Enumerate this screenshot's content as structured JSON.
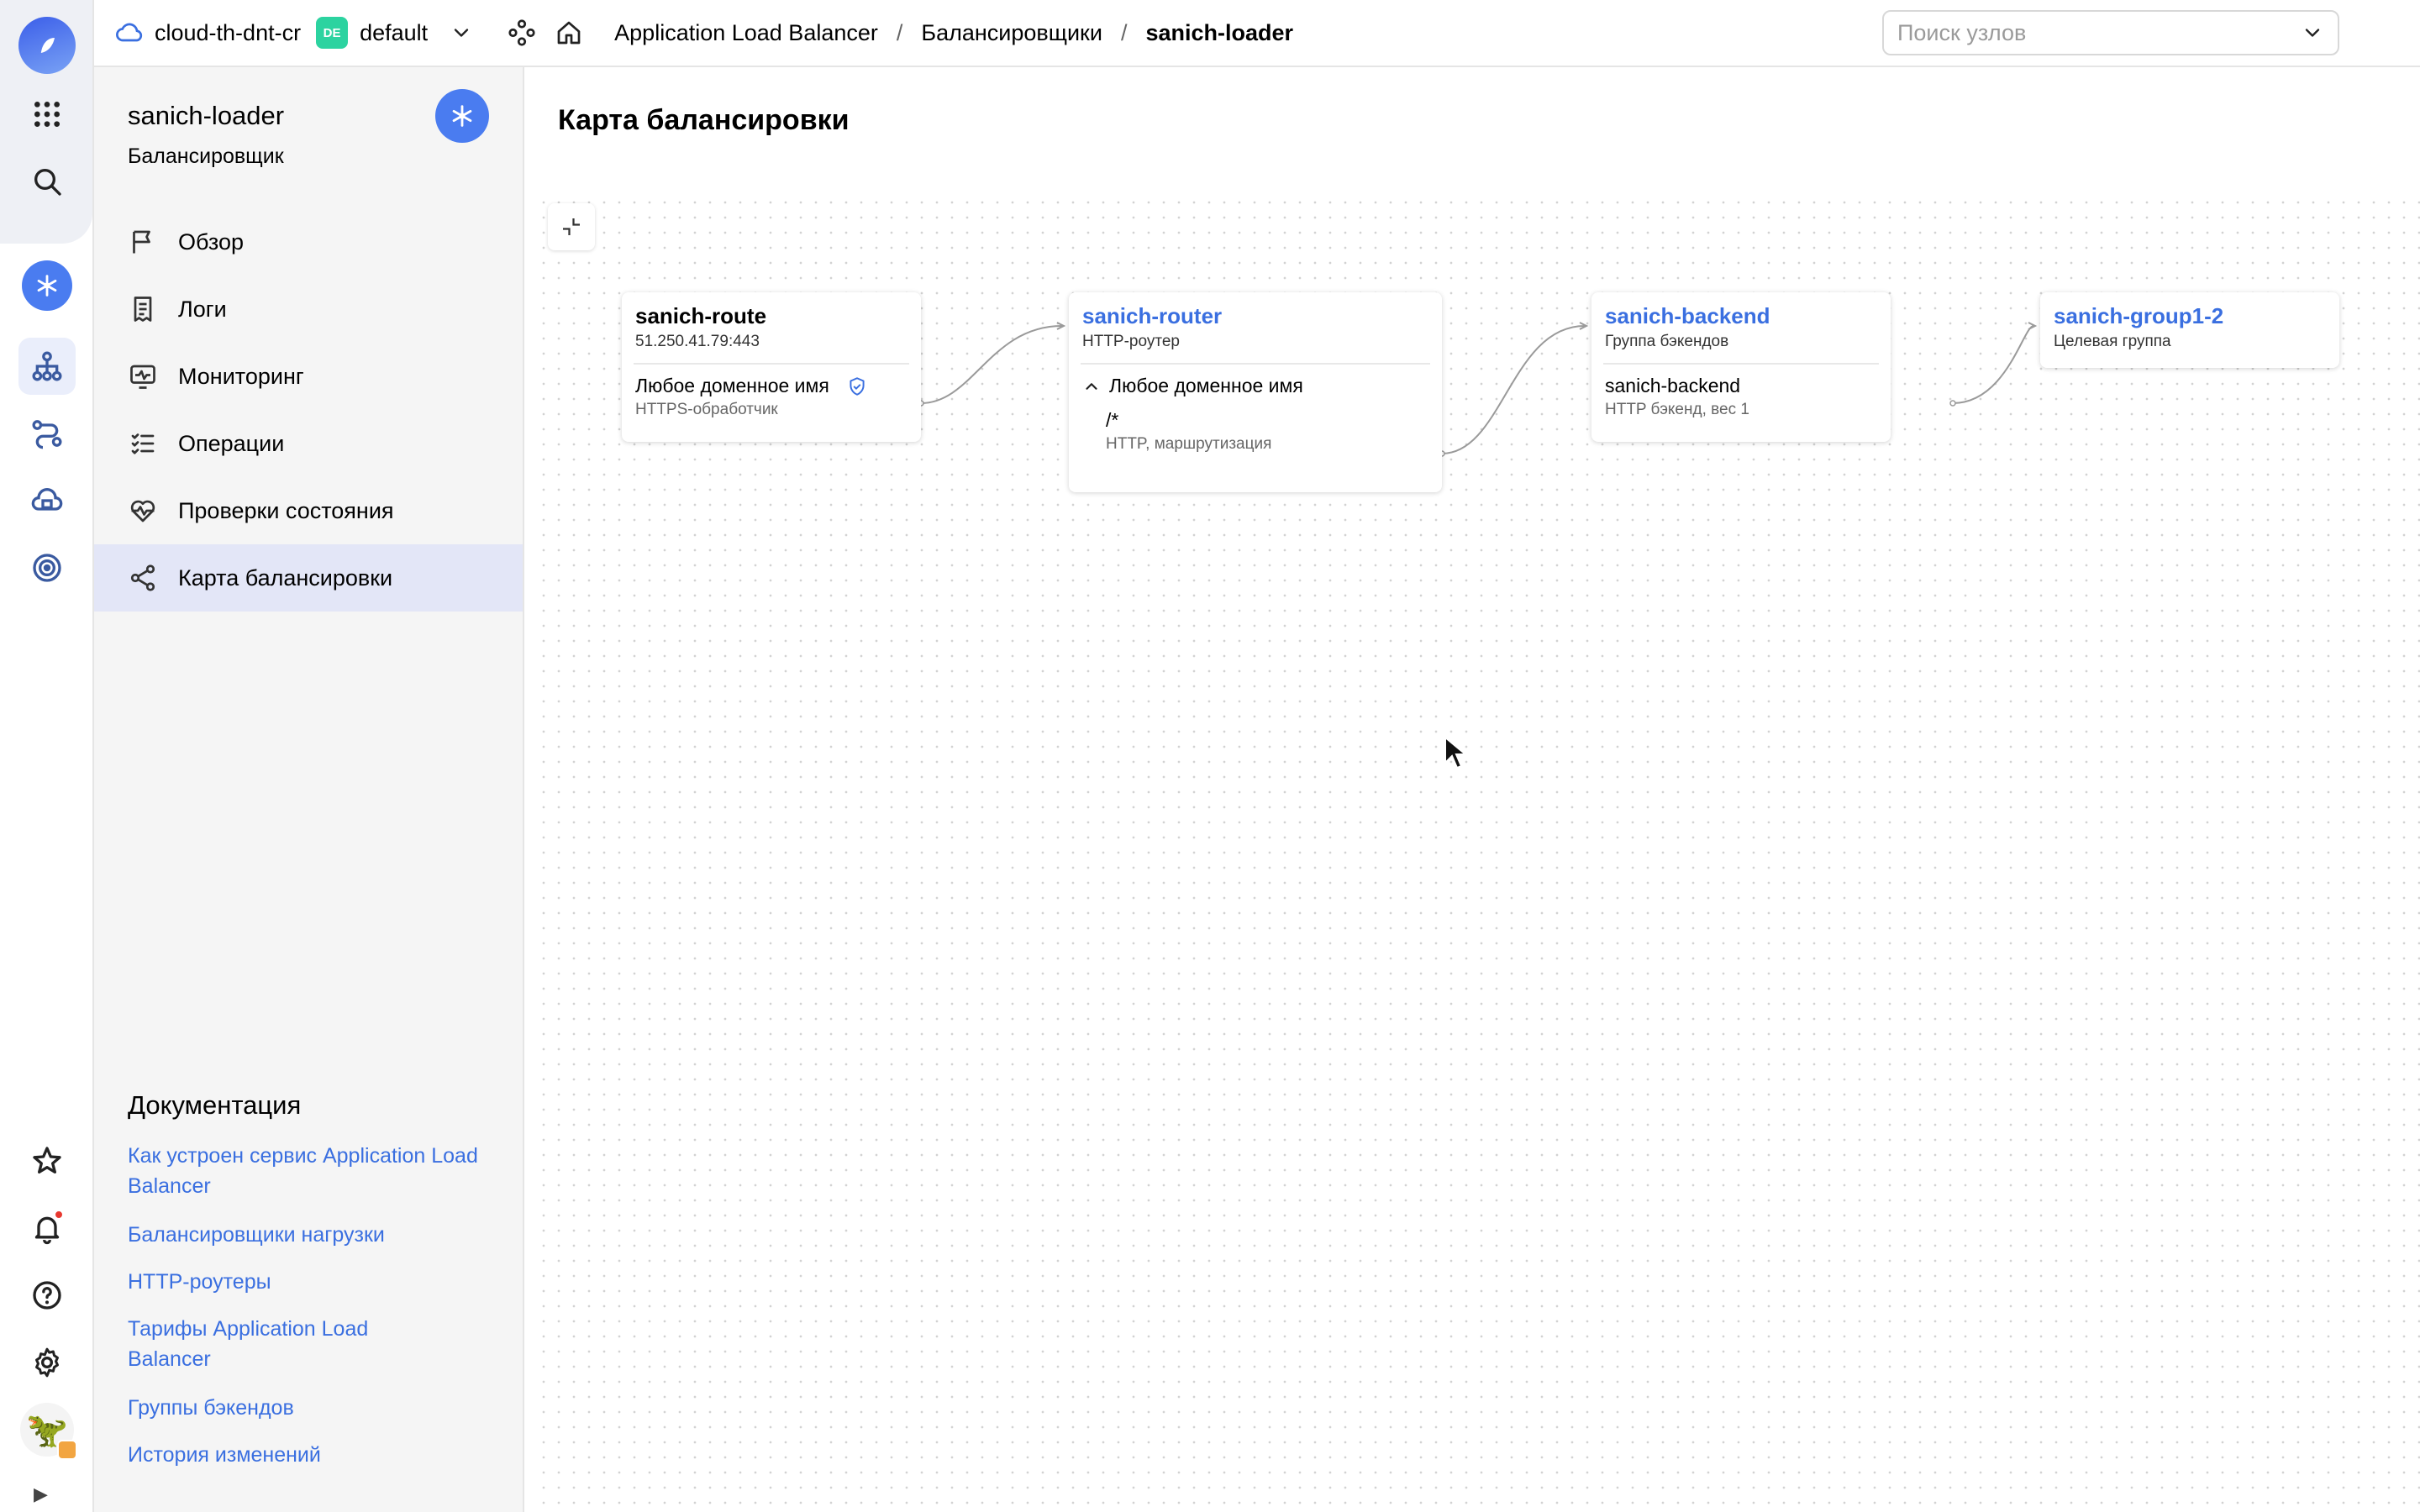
{
  "header": {
    "cloud_name": "cloud-th-dnt-cr",
    "folder_badge": "DE",
    "folder_name": "default",
    "breadcrumbs": [
      "Application Load Balancer",
      "Балансировщики",
      "sanich-loader"
    ],
    "search_placeholder": "Поиск узлов"
  },
  "sidebar": {
    "resource_name": "sanich-loader",
    "resource_type": "Балансировщик",
    "nav": [
      {
        "label": "Обзор",
        "icon": "flag-icon"
      },
      {
        "label": "Логи",
        "icon": "logs-icon"
      },
      {
        "label": "Мониторинг",
        "icon": "monitoring-icon"
      },
      {
        "label": "Операции",
        "icon": "operations-list-icon"
      },
      {
        "label": "Проверки состояния",
        "icon": "heartbeat-icon"
      },
      {
        "label": "Карта балансировки",
        "icon": "map-share-icon",
        "active": true
      }
    ],
    "docs_title": "Документация",
    "docs_links": [
      "Как устроен сервис Application Load Balancer",
      "Балансировщики нагрузки",
      "HTTP-роутеры",
      "Тарифы Application Load Balancer",
      "Группы бэкендов",
      "История изменений"
    ]
  },
  "main": {
    "title": "Карта балансировки",
    "nodes": {
      "listener": {
        "name": "sanich-route",
        "address": "51.250.41.79:443",
        "row_title": "Любое доменное имя",
        "row_sub": "HTTPS-обработчик"
      },
      "router": {
        "name": "sanich-router",
        "type": "HTTP-роутер",
        "host_title": "Любое доменное имя",
        "route_path": "/*",
        "route_sub": "HTTP, маршрутизация"
      },
      "backend_group": {
        "name": "sanich-backend",
        "type": "Группа бэкендов",
        "backend_name": "sanich-backend",
        "backend_sub": "HTTP бэкенд, вес 1"
      },
      "target_group": {
        "name": "sanich-group1-2",
        "type": "Целевая группа"
      }
    }
  },
  "colors": {
    "accent": "#4a7cf0",
    "link": "#3a6fe0",
    "active_nav_bg": "#e3e6f7",
    "folder_badge": "#2cd3a0"
  }
}
